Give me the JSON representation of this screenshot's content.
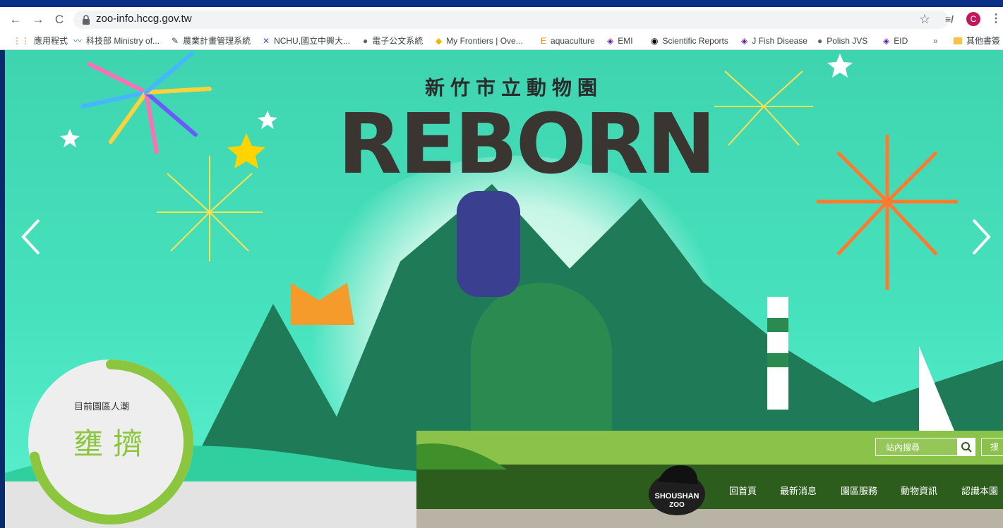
{
  "browser": {
    "url": "zoo-info.hccg.gov.tw",
    "avatar_letter": "C",
    "bookmarks": [
      {
        "label": "應用程式",
        "icon": "apps-grid-icon"
      },
      {
        "label": "科技部 Ministry of...",
        "icon": "most-logo-icon"
      },
      {
        "label": "農業計畫管理系統",
        "icon": "edit-note-icon"
      },
      {
        "label": "NCHU,國立中興大...",
        "icon": "nchu-logo-icon"
      },
      {
        "label": "電子公文系統",
        "icon": "globe-icon"
      },
      {
        "label": "My Frontiers | Ove...",
        "icon": "frontiers-icon"
      },
      {
        "label": "aquaculture",
        "icon": "elsevier-icon"
      },
      {
        "label": "EMI",
        "icon": "wiley-icon"
      },
      {
        "label": "Scientific Reports",
        "icon": "nature-icon"
      },
      {
        "label": "J Fish Disease",
        "icon": "wiley-icon"
      },
      {
        "label": "Polish JVS",
        "icon": "globe-icon"
      },
      {
        "label": "EID",
        "icon": "wiley-icon"
      }
    ],
    "overflow_label": "»",
    "other_bookmarks": "其他書簽"
  },
  "hero": {
    "subtitle": "新竹市立動物園",
    "title": "REBORN"
  },
  "crowd": {
    "label": "目前園區人潮",
    "value": "壅擠",
    "level_fraction": 0.72
  },
  "shoushan": {
    "search_placeholder": "站內搜尋",
    "extra_button": "搜",
    "logo_text_1": "SHOUSHAN",
    "logo_text_2": "ZOO",
    "menu": [
      "回首頁",
      "最新消息",
      "園區服務",
      "動物資訊",
      "認識本園"
    ]
  },
  "colors": {
    "hero_bg": "#46e2bd",
    "crowd_accent": "#8cc63f",
    "shoushan_green": "#2d5d1c",
    "shoushan_light_green": "#8bc34a"
  }
}
